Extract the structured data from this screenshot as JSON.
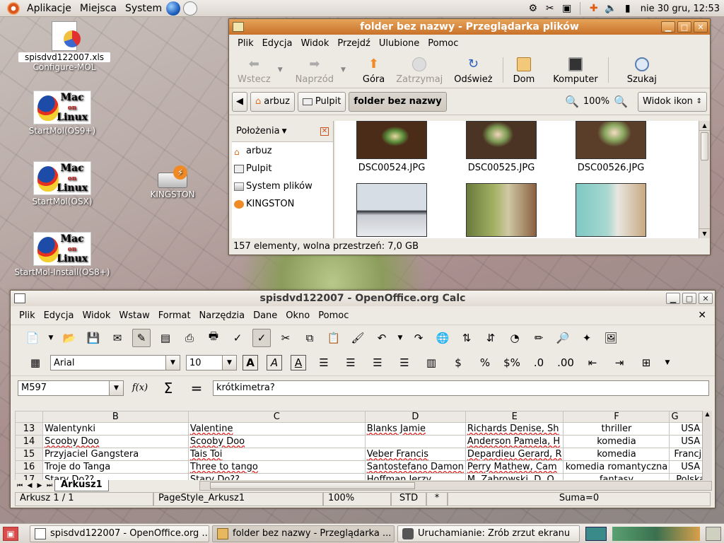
{
  "panel": {
    "menus": [
      "Aplikacje",
      "Miejsca",
      "System"
    ],
    "clock": "nie 30 gru, 12:53"
  },
  "desktop": [
    {
      "label": "spisdvd122007.xls",
      "label2": "Configure-MOL",
      "icon": "spreadsheet-file-icon"
    },
    {
      "label": "StartMol(OS9+)",
      "icon": "mac-on-linux-icon"
    },
    {
      "label": "StartMol(OSX)",
      "icon": "mac-on-linux-icon"
    },
    {
      "label": "KINGSTON",
      "icon": "usb-drive-icon"
    },
    {
      "label": "StartMol-Install(OS8+)",
      "icon": "mac-on-linux-icon"
    }
  ],
  "mol_logo": {
    "line1": "Mac",
    "line2": "on",
    "line3": "Linux"
  },
  "nautilus": {
    "title": "folder bez nazwy - Przeglądarka plików",
    "menu": [
      "Plik",
      "Edycja",
      "Widok",
      "Przejdź",
      "Ulubione",
      "Pomoc"
    ],
    "toolbar": {
      "back": "Wstecz",
      "forward": "Naprzód",
      "up": "Góra",
      "stop": "Zatrzymaj",
      "reload": "Odśwież",
      "home": "Dom",
      "computer": "Komputer",
      "search": "Szukaj"
    },
    "path": [
      "arbuz",
      "Pulpit",
      "folder bez nazwy"
    ],
    "zoom": "100%",
    "view": "Widok ikon",
    "sidebar": {
      "title": "Położenia",
      "items": [
        "arbuz",
        "Pulpit",
        "System plików",
        "KINGSTON"
      ]
    },
    "files": [
      "DSC00524.JPG",
      "DSC00525.JPG",
      "DSC00526.JPG"
    ],
    "status": "157 elementy, wolna przestrzeń: 7,0 GB"
  },
  "calc": {
    "title": "spisdvd122007 - OpenOffice.org Calc",
    "menu": [
      "Plik",
      "Edycja",
      "Widok",
      "Wstaw",
      "Format",
      "Narzędzia",
      "Dane",
      "Okno",
      "Pomoc"
    ],
    "font": "Arial",
    "size": "10",
    "namebox": "M597",
    "formula": "krótkimetra?",
    "columns": [
      "B",
      "C",
      "D",
      "E",
      "F",
      "G"
    ],
    "rows": [
      {
        "n": "13",
        "b": "Walentynki",
        "c": "Valentine",
        "d": "Blanks Jamie",
        "e": "Richards Denise, Sh",
        "f": "thriller",
        "g": "USA"
      },
      {
        "n": "14",
        "b": "Scooby Doo",
        "c": "Scooby Doo",
        "d": "",
        "e": "Anderson Pamela, H",
        "f": "komedia",
        "g": "USA"
      },
      {
        "n": "15",
        "b": "Przyjaciel Gangstera",
        "c": "Tais Toi",
        "d": "Veber Francis",
        "e": "Depardieu Gerard, R",
        "f": "komedia",
        "g": "Francja"
      },
      {
        "n": "16",
        "b": "Troje do Tanga",
        "c": "Three to tango",
        "d": "Santostefano Damon",
        "e": "Perry Mathew, Cam",
        "f": "komedia romantyczna",
        "g": "USA"
      },
      {
        "n": "17",
        "b": "Stary Do??",
        "c": "Stary Do??",
        "d": "Hoffman Jerzy",
        "e": "M. Zabrowski, D. O",
        "f": "fantasy",
        "g": "Polska"
      }
    ],
    "sheet_tab": "Arkusz1",
    "status": {
      "sheet": "Arkusz 1 / 1",
      "style": "PageStyle_Arkusz1",
      "zoom": "100%",
      "mode": "STD",
      "mod": "*",
      "sum": "Suma=0"
    }
  },
  "taskbar": [
    {
      "label": "spisdvd122007 - OpenOffice.org ...",
      "icon": "calc-icon"
    },
    {
      "label": "folder bez nazwy - Przeglądarka ...",
      "icon": "folder-icon"
    },
    {
      "label": "Uruchamianie: Zrób zrzut ekranu",
      "icon": "camera-icon"
    }
  ]
}
